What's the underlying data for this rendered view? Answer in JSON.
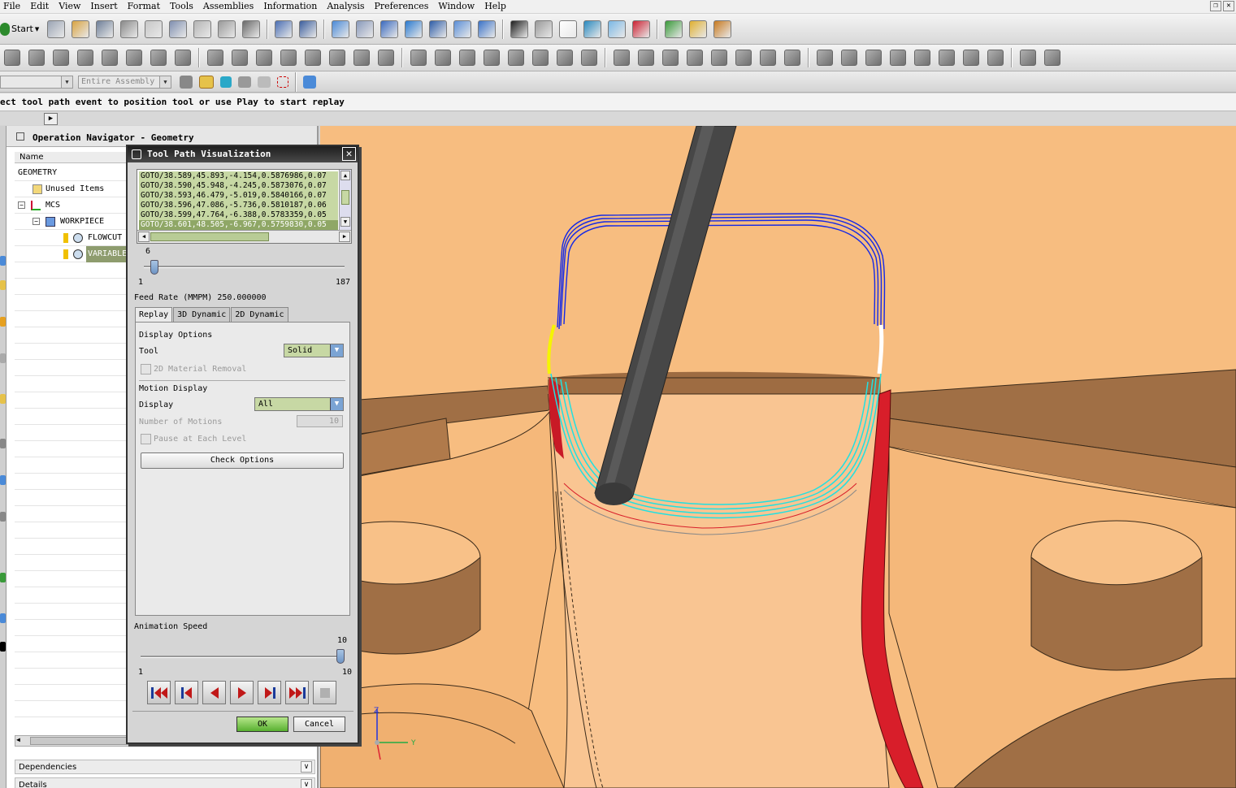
{
  "menu": [
    "File",
    "Edit",
    "View",
    "Insert",
    "Format",
    "Tools",
    "Assemblies",
    "Information",
    "Analysis",
    "Preferences",
    "Window",
    "Help"
  ],
  "toolbar": {
    "start_label": "Start",
    "selection_scope": "Entire Assembly",
    "icon_names": [
      "new-icon",
      "open-icon",
      "save-icon",
      "print-icon",
      "cut-icon",
      "copy-icon",
      "paste-icon",
      "delete-icon",
      "undo-icon",
      "information-icon",
      "edit-object-icon",
      "fit-icon",
      "zoom-window-icon",
      "zoom-icon",
      "pan-icon",
      "rotate-icon",
      "view-icon",
      "orient-view-icon",
      "render-style-icon",
      "shaded-icon",
      "background-icon",
      "layer-icon",
      "snap-point-icon",
      "wcs-icon",
      "select-icon",
      "measure-icon",
      "analysis-icon"
    ]
  },
  "cue_line": "ect tool path event to position tool or use Play to start replay",
  "navigator": {
    "title": "Operation Navigator - Geometry",
    "column_header": "Name",
    "rows": [
      {
        "label": "GEOMETRY",
        "indent": 0
      },
      {
        "label": "Unused Items",
        "indent": 1
      },
      {
        "label": "MCS",
        "indent": 1
      },
      {
        "label": "WORKPIECE",
        "indent": 2
      },
      {
        "label": "FLOWCUT",
        "indent": 3
      },
      {
        "label": "VARIABLE",
        "indent": 3,
        "selected": true
      }
    ],
    "dependencies_label": "Dependencies",
    "details_label": "Details"
  },
  "dialog": {
    "title": "Tool Path Visualization",
    "goto_lines": [
      "GOTO/38.589,45.893,-4.154,0.5876986,0.07",
      "GOTO/38.590,45.948,-4.245,0.5873076,0.07",
      "GOTO/38.593,46.479,-5.019,0.5840166,0.07",
      "GOTO/38.596,47.086,-5.736,0.5810187,0.06",
      "GOTO/38.599,47.764,-6.388,0.5783359,0.05",
      "GOTO/38.601,48.505,-6.967,0.5759830,0.05"
    ],
    "motion_slider": {
      "current": "6",
      "min": "1",
      "max": "187",
      "value": 6,
      "range_min": 1,
      "range_max": 187
    },
    "feed_rate_label": "Feed Rate (MMPM) 250.000000",
    "tabs": [
      "Replay",
      "3D Dynamic",
      "2D Dynamic"
    ],
    "display_options_label": "Display Options",
    "tool_label": "Tool",
    "tool_value": "Solid",
    "material_removal_label": "2D Material Removal",
    "motion_display_label": "Motion Display",
    "display_label": "Display",
    "display_value": "All",
    "num_motions_label": "Number of Motions",
    "num_motions_value": "10",
    "pause_label": "Pause at Each Level",
    "check_options_label": "Check Options",
    "anim_speed_label": "Animation Speed",
    "anim_slider": {
      "current": "10",
      "min": "1",
      "max": "10",
      "value": 10,
      "range_min": 1,
      "range_max": 10
    },
    "vcr_buttons": [
      "rewind-to-start-icon",
      "step-back-icon",
      "play-reverse-icon",
      "play-forward-icon",
      "step-forward-icon",
      "fast-forward-icon",
      "stop-icon"
    ],
    "ok_label": "OK",
    "cancel_label": "Cancel"
  },
  "triad": {
    "z": "Z",
    "y": "Y"
  },
  "colors": {
    "part": "#f7bd80",
    "part_shadow": "#9a6a43",
    "tool": "#484848",
    "path_blue": "#1428e6",
    "path_cyan": "#22e0e0",
    "path_yellow": "#f5f500",
    "path_red": "#d81e2a",
    "dialog_title": "#2a2a2a",
    "ok_green": "#58b030"
  }
}
